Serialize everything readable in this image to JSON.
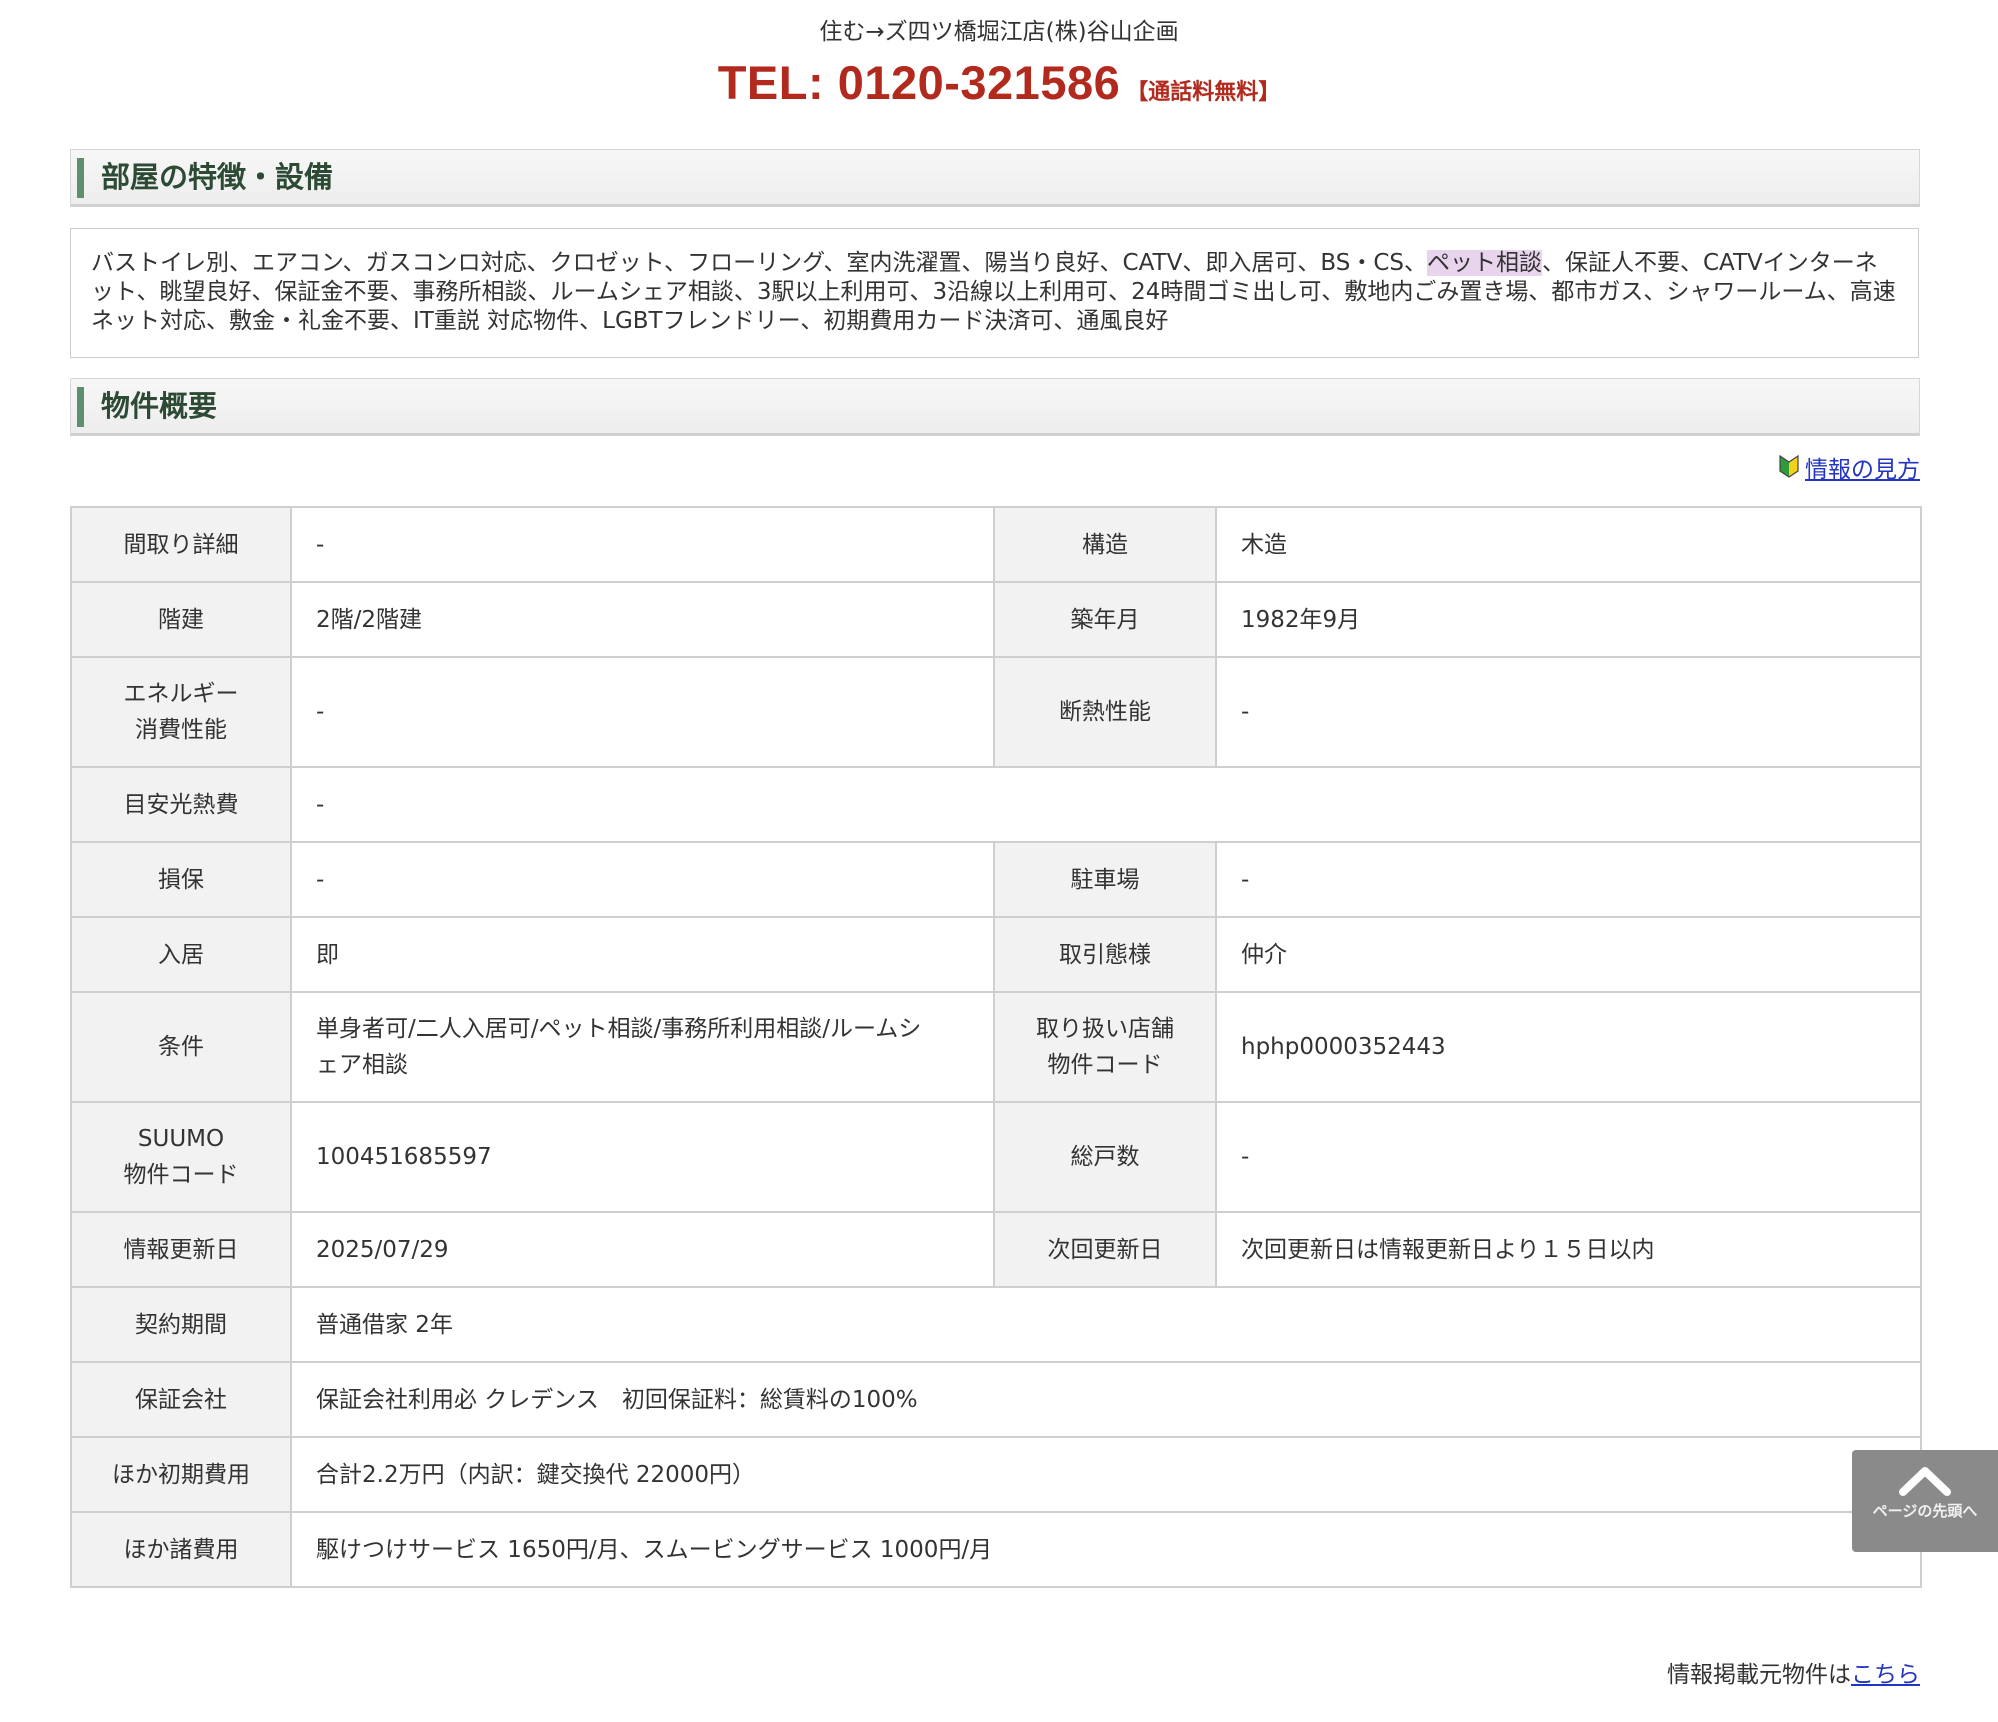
{
  "header": {
    "shop_name": "住む→ズ四ツ橋堀江店(株)谷山企画",
    "tel": "TEL: 0120-321586",
    "tel_note": "【通話料無料】"
  },
  "features": {
    "title": "部屋の特徴・設備",
    "text_before": "バストイレ別、エアコン、ガスコンロ対応、クロゼット、フローリング、室内洗濯置、陽当り良好、CATV、即入居可、BS・CS、",
    "highlight": "ペット相談",
    "text_after": "、保証人不要、CATVインターネット、眺望良好、保証金不要、事務所相談、ルームシェア相談、3駅以上利用可、3沿線以上利用可、24時間ゴミ出し可、敷地内ごみ置き場、都市ガス、シャワールーム、高速ネット対応、敷金・礼金不要、IT重説 対応物件、LGBTフレンドリー、初期費用カード決済可、通風良好"
  },
  "overview": {
    "title": "物件概要",
    "info_link": "情報の見方",
    "rows": {
      "madori_label": "間取り詳細",
      "madori_value": "-",
      "kozo_label": "構造",
      "kozo_value": "木造",
      "kaidate_label": "階建",
      "kaidate_value": "2階/2階建",
      "chiku_label": "築年月",
      "chiku_value": "1982年9月",
      "energy_label_1": "エネルギー",
      "energy_label_2": "消費性能",
      "energy_value": "-",
      "dannetsu_label": "断熱性能",
      "dannetsu_value": "-",
      "kounetsu_label": "目安光熱費",
      "kounetsu_value": "-",
      "sonpo_label": "損保",
      "sonpo_value": "-",
      "parking_label": "駐車場",
      "parking_value": "-",
      "nyukyo_label": "入居",
      "nyukyo_value": "即",
      "torihiki_label": "取引態様",
      "torihiki_value": "仲介",
      "joken_label": "条件",
      "joken_value_1": "単身者可/二人入居可/ペット相談/事務所利用相談/ルームシ",
      "joken_value_2": "ェア相談",
      "store_code_label_1": "取り扱い店舗",
      "store_code_label_2": "物件コード",
      "store_code_value": "hphp0000352443",
      "suumo_label_1": "SUUMO",
      "suumo_label_2": "物件コード",
      "suumo_value": "100451685597",
      "soko_label": "総戸数",
      "soko_value": "-",
      "update_label": "情報更新日",
      "update_value": "2025/07/29",
      "next_update_label": "次回更新日",
      "next_update_value": "次回更新日は情報更新日より１５日以内",
      "contract_label": "契約期間",
      "contract_value": "普通借家 2年",
      "guarantor_label": "保証会社",
      "guarantor_value": "保証会社利用必 クレデンス　初回保証料：総賃料の100%",
      "initial_label": "ほか初期費用",
      "initial_value": "合計2.2万円（内訳：鍵交換代 22000円）",
      "other_label": "ほか諸費用",
      "other_value": "駆けつけサービス 1650円/月、スムービングサービス 1000円/月"
    }
  },
  "footer": {
    "source_text": "情報掲載元物件は",
    "source_link": "こちら"
  },
  "pagetop": {
    "label": "ページの先頭へ",
    "icon": "chevron-up-icon"
  },
  "colors": {
    "tel_red": "#b22a1e",
    "section_bar": "#5f8f6b",
    "link_blue": "#2234c2",
    "highlight": "#e8d4ec"
  }
}
